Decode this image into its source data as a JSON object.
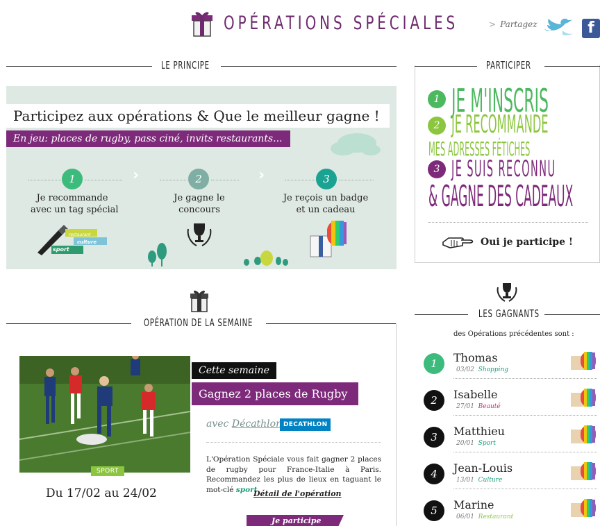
{
  "header": {
    "title": "OPÉRATIONS SPÉCIALES",
    "share_label": "Partagez",
    "share_chevron": ">",
    "facebook_glyph": "f"
  },
  "principe": {
    "section_title": "LE PRINCIPE",
    "headline": "Participez aux opérations & Que le meilleur gagne !",
    "subline": "En jeu: places de rugby, pass ciné, invits restaurants...",
    "steps": [
      {
        "number": "1",
        "line1": "Je recommande",
        "line2": "avec un tag spécial",
        "color": "#3dbb7c"
      },
      {
        "number": "2",
        "line1": "Je gagne le",
        "line2": "concours",
        "color": "#7faea5"
      },
      {
        "number": "3",
        "line1": "Je reçois un badge",
        "line2": "et un cadeau",
        "color": "#1aa393"
      }
    ],
    "step_chevron": "›",
    "tags": [
      "restaurant",
      "culture",
      "sport"
    ]
  },
  "participer": {
    "section_title": "PARTICIPER",
    "line1_num": "1",
    "line1": "JE M'INSCRIS",
    "line2_num": "2",
    "line2": "JE RECOMMANDE",
    "line3": "MES ADRESSES FÉTICHES",
    "line4_num": "3",
    "line4": "JE SUIS RECONNU",
    "line5": "& GAGNE DES CADEAUX",
    "cta": "Oui je participe !",
    "colors": {
      "green": "#4cb85f",
      "lime": "#8cc63f",
      "purple": "#7d2a7a"
    }
  },
  "operation": {
    "section_title": "OPÉRATION DE LA SEMAINE",
    "badge_this_week": "Cette semaine",
    "title": "Gagnez 2 places de Rugby",
    "with_prefix": "avec",
    "with_brand": "Décathlon",
    "brand_logo": "DECATHLON",
    "photo_tag": "SPORT",
    "dates": "Du 17/02 au 24/02",
    "description": "L'Opération Spéciale vous fait gagner 2 places de rugby pour France-Italie à Paris. Recommandez les plus de lieux en taguant  le mot-clé",
    "keyword": "sport",
    "description_end": ".",
    "detail_link": "Détail de l'opération",
    "cta": "Je participe"
  },
  "gagnants": {
    "section_title": "LES GAGNANTS",
    "subtitle": "des Opérations précédentes sont :",
    "winners": [
      {
        "rank": "1",
        "name": "Thomas",
        "date": "03/02",
        "category": "Shopping",
        "cat_color": "#1a9b7a",
        "rank_color": "#3dbb7c"
      },
      {
        "rank": "2",
        "name": "Isabelle",
        "date": "27/01",
        "category": "Beauté",
        "cat_color": "#c0307a",
        "rank_color": "#111111"
      },
      {
        "rank": "3",
        "name": "Matthieu",
        "date": "20/01",
        "category": "Sport",
        "cat_color": "#1a9b7a",
        "rank_color": "#111111"
      },
      {
        "rank": "4",
        "name": "Jean-Louis",
        "date": "13/01",
        "category": "Culture",
        "cat_color": "#1a9b7a",
        "rank_color": "#111111"
      },
      {
        "rank": "5",
        "name": "Marine",
        "date": "06/01",
        "category": "Restaurant",
        "cat_color": "#8cc63f",
        "rank_color": "#111111"
      }
    ]
  }
}
